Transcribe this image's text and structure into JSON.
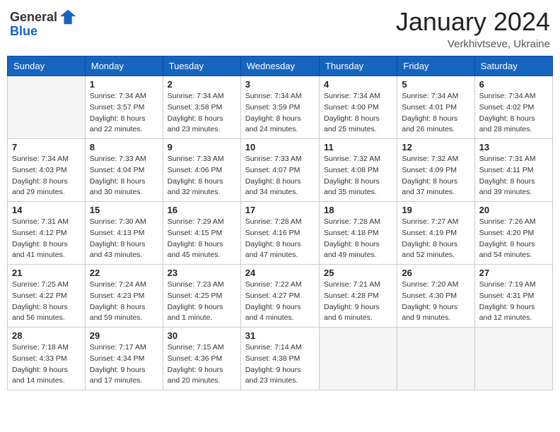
{
  "logo": {
    "general": "General",
    "blue": "Blue"
  },
  "header": {
    "month": "January 2024",
    "location": "Verkhivtseve, Ukraine"
  },
  "weekdays": [
    "Sunday",
    "Monday",
    "Tuesday",
    "Wednesday",
    "Thursday",
    "Friday",
    "Saturday"
  ],
  "weeks": [
    [
      {
        "day": "",
        "empty": true
      },
      {
        "day": "1",
        "sunrise": "Sunrise: 7:34 AM",
        "sunset": "Sunset: 3:57 PM",
        "daylight": "Daylight: 8 hours and 22 minutes."
      },
      {
        "day": "2",
        "sunrise": "Sunrise: 7:34 AM",
        "sunset": "Sunset: 3:58 PM",
        "daylight": "Daylight: 8 hours and 23 minutes."
      },
      {
        "day": "3",
        "sunrise": "Sunrise: 7:34 AM",
        "sunset": "Sunset: 3:59 PM",
        "daylight": "Daylight: 8 hours and 24 minutes."
      },
      {
        "day": "4",
        "sunrise": "Sunrise: 7:34 AM",
        "sunset": "Sunset: 4:00 PM",
        "daylight": "Daylight: 8 hours and 25 minutes."
      },
      {
        "day": "5",
        "sunrise": "Sunrise: 7:34 AM",
        "sunset": "Sunset: 4:01 PM",
        "daylight": "Daylight: 8 hours and 26 minutes."
      },
      {
        "day": "6",
        "sunrise": "Sunrise: 7:34 AM",
        "sunset": "Sunset: 4:02 PM",
        "daylight": "Daylight: 8 hours and 28 minutes."
      }
    ],
    [
      {
        "day": "7",
        "sunrise": "Sunrise: 7:34 AM",
        "sunset": "Sunset: 4:03 PM",
        "daylight": "Daylight: 8 hours and 29 minutes."
      },
      {
        "day": "8",
        "sunrise": "Sunrise: 7:33 AM",
        "sunset": "Sunset: 4:04 PM",
        "daylight": "Daylight: 8 hours and 30 minutes."
      },
      {
        "day": "9",
        "sunrise": "Sunrise: 7:33 AM",
        "sunset": "Sunset: 4:06 PM",
        "daylight": "Daylight: 8 hours and 32 minutes."
      },
      {
        "day": "10",
        "sunrise": "Sunrise: 7:33 AM",
        "sunset": "Sunset: 4:07 PM",
        "daylight": "Daylight: 8 hours and 34 minutes."
      },
      {
        "day": "11",
        "sunrise": "Sunrise: 7:32 AM",
        "sunset": "Sunset: 4:08 PM",
        "daylight": "Daylight: 8 hours and 35 minutes."
      },
      {
        "day": "12",
        "sunrise": "Sunrise: 7:32 AM",
        "sunset": "Sunset: 4:09 PM",
        "daylight": "Daylight: 8 hours and 37 minutes."
      },
      {
        "day": "13",
        "sunrise": "Sunrise: 7:31 AM",
        "sunset": "Sunset: 4:11 PM",
        "daylight": "Daylight: 8 hours and 39 minutes."
      }
    ],
    [
      {
        "day": "14",
        "sunrise": "Sunrise: 7:31 AM",
        "sunset": "Sunset: 4:12 PM",
        "daylight": "Daylight: 8 hours and 41 minutes."
      },
      {
        "day": "15",
        "sunrise": "Sunrise: 7:30 AM",
        "sunset": "Sunset: 4:13 PM",
        "daylight": "Daylight: 8 hours and 43 minutes."
      },
      {
        "day": "16",
        "sunrise": "Sunrise: 7:29 AM",
        "sunset": "Sunset: 4:15 PM",
        "daylight": "Daylight: 8 hours and 45 minutes."
      },
      {
        "day": "17",
        "sunrise": "Sunrise: 7:28 AM",
        "sunset": "Sunset: 4:16 PM",
        "daylight": "Daylight: 8 hours and 47 minutes."
      },
      {
        "day": "18",
        "sunrise": "Sunrise: 7:28 AM",
        "sunset": "Sunset: 4:18 PM",
        "daylight": "Daylight: 8 hours and 49 minutes."
      },
      {
        "day": "19",
        "sunrise": "Sunrise: 7:27 AM",
        "sunset": "Sunset: 4:19 PM",
        "daylight": "Daylight: 8 hours and 52 minutes."
      },
      {
        "day": "20",
        "sunrise": "Sunrise: 7:26 AM",
        "sunset": "Sunset: 4:20 PM",
        "daylight": "Daylight: 8 hours and 54 minutes."
      }
    ],
    [
      {
        "day": "21",
        "sunrise": "Sunrise: 7:25 AM",
        "sunset": "Sunset: 4:22 PM",
        "daylight": "Daylight: 8 hours and 56 minutes."
      },
      {
        "day": "22",
        "sunrise": "Sunrise: 7:24 AM",
        "sunset": "Sunset: 4:23 PM",
        "daylight": "Daylight: 8 hours and 59 minutes."
      },
      {
        "day": "23",
        "sunrise": "Sunrise: 7:23 AM",
        "sunset": "Sunset: 4:25 PM",
        "daylight": "Daylight: 9 hours and 1 minute."
      },
      {
        "day": "24",
        "sunrise": "Sunrise: 7:22 AM",
        "sunset": "Sunset: 4:27 PM",
        "daylight": "Daylight: 9 hours and 4 minutes."
      },
      {
        "day": "25",
        "sunrise": "Sunrise: 7:21 AM",
        "sunset": "Sunset: 4:28 PM",
        "daylight": "Daylight: 9 hours and 6 minutes."
      },
      {
        "day": "26",
        "sunrise": "Sunrise: 7:20 AM",
        "sunset": "Sunset: 4:30 PM",
        "daylight": "Daylight: 9 hours and 9 minutes."
      },
      {
        "day": "27",
        "sunrise": "Sunrise: 7:19 AM",
        "sunset": "Sunset: 4:31 PM",
        "daylight": "Daylight: 9 hours and 12 minutes."
      }
    ],
    [
      {
        "day": "28",
        "sunrise": "Sunrise: 7:18 AM",
        "sunset": "Sunset: 4:33 PM",
        "daylight": "Daylight: 9 hours and 14 minutes."
      },
      {
        "day": "29",
        "sunrise": "Sunrise: 7:17 AM",
        "sunset": "Sunset: 4:34 PM",
        "daylight": "Daylight: 9 hours and 17 minutes."
      },
      {
        "day": "30",
        "sunrise": "Sunrise: 7:15 AM",
        "sunset": "Sunset: 4:36 PM",
        "daylight": "Daylight: 9 hours and 20 minutes."
      },
      {
        "day": "31",
        "sunrise": "Sunrise: 7:14 AM",
        "sunset": "Sunset: 4:38 PM",
        "daylight": "Daylight: 9 hours and 23 minutes."
      },
      {
        "day": "",
        "empty": true
      },
      {
        "day": "",
        "empty": true
      },
      {
        "day": "",
        "empty": true
      }
    ]
  ]
}
